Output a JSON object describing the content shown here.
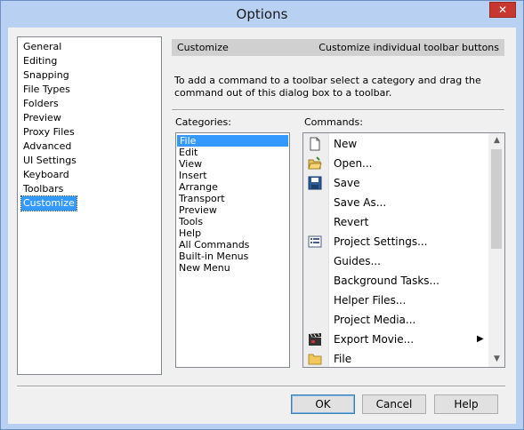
{
  "window": {
    "title": "Options",
    "close_symbol": "✕"
  },
  "nav": {
    "items": [
      {
        "label": "General"
      },
      {
        "label": "Editing"
      },
      {
        "label": "Snapping"
      },
      {
        "label": "File Types"
      },
      {
        "label": "Folders"
      },
      {
        "label": "Preview"
      },
      {
        "label": "Proxy Files"
      },
      {
        "label": "Advanced"
      },
      {
        "label": "UI Settings"
      },
      {
        "label": "Keyboard"
      },
      {
        "label": "Toolbars"
      },
      {
        "label": "Customize"
      }
    ],
    "selected": "Customize"
  },
  "panel": {
    "header_title": "Customize",
    "header_subtitle": "Customize individual toolbar buttons",
    "instructions": "To add a command to a toolbar select a category and drag the command out of this dialog box to a toolbar.",
    "categories_label": "Categories:",
    "commands_label": "Commands:"
  },
  "categories": {
    "items": [
      "File",
      "Edit",
      "View",
      "Insert",
      "Arrange",
      "Transport",
      "Preview",
      "Tools",
      "Help",
      "All Commands",
      "Built-in Menus",
      "New Menu"
    ],
    "selected": "File"
  },
  "commands": {
    "items": [
      {
        "label": "New",
        "icon": "new-document-icon"
      },
      {
        "label": "Open...",
        "icon": "open-folder-icon"
      },
      {
        "label": "Save",
        "icon": "save-disk-icon"
      },
      {
        "label": "Save As...",
        "icon": ""
      },
      {
        "label": "Revert",
        "icon": ""
      },
      {
        "label": "Project Settings...",
        "icon": "project-settings-icon"
      },
      {
        "label": "Guides...",
        "icon": ""
      },
      {
        "label": "Background Tasks...",
        "icon": ""
      },
      {
        "label": "Helper Files...",
        "icon": ""
      },
      {
        "label": "Project Media...",
        "icon": ""
      },
      {
        "label": "Export Movie...",
        "icon": "clapperboard-icon",
        "submenu": true
      },
      {
        "label": "File",
        "icon": "folder-icon"
      }
    ],
    "submenu_arrow": "▶",
    "scroll_up": "▲",
    "scroll_down": "▼"
  },
  "buttons": {
    "ok": "OK",
    "cancel": "Cancel",
    "help": "Help"
  }
}
